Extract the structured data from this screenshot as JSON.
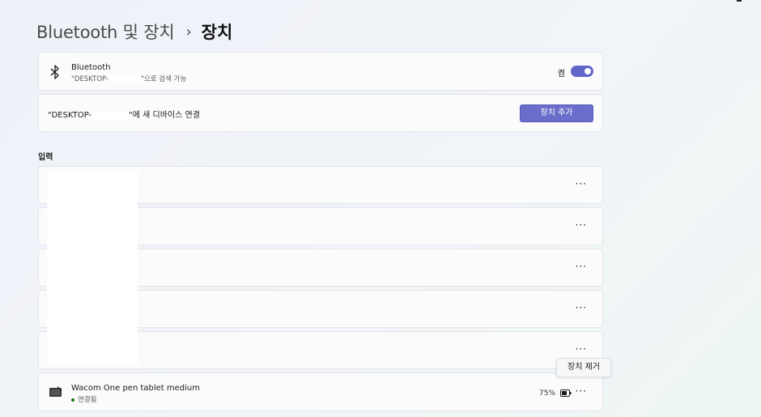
{
  "breadcrumb": {
    "parent": "Bluetooth 및 장치",
    "separator": "›",
    "current": "장치"
  },
  "bluetooth": {
    "title": "Bluetooth",
    "subtitle_prefix": "\"DESKTOP-",
    "subtitle_suffix": "\"으로 검색 가능",
    "toggle_label": "켬",
    "toggle_on": true,
    "accent_color": "#6266c9"
  },
  "add_device": {
    "text_prefix": "\"DESKTOP-",
    "text_suffix": "\"에 새 디바이스 연결",
    "button_label": "장치 추가"
  },
  "input_section": {
    "heading": "입력",
    "rows": [
      {
        "more": "···"
      },
      {
        "more": "···"
      },
      {
        "more": "···"
      },
      {
        "more": "···"
      },
      {
        "more": "···"
      }
    ]
  },
  "tooltip": {
    "label": "장치 제거"
  },
  "wacom": {
    "name": "Wacom One pen tablet medium",
    "status": "연결됨",
    "status_color": "#0f7b0f",
    "battery": "75%",
    "more": "···"
  }
}
